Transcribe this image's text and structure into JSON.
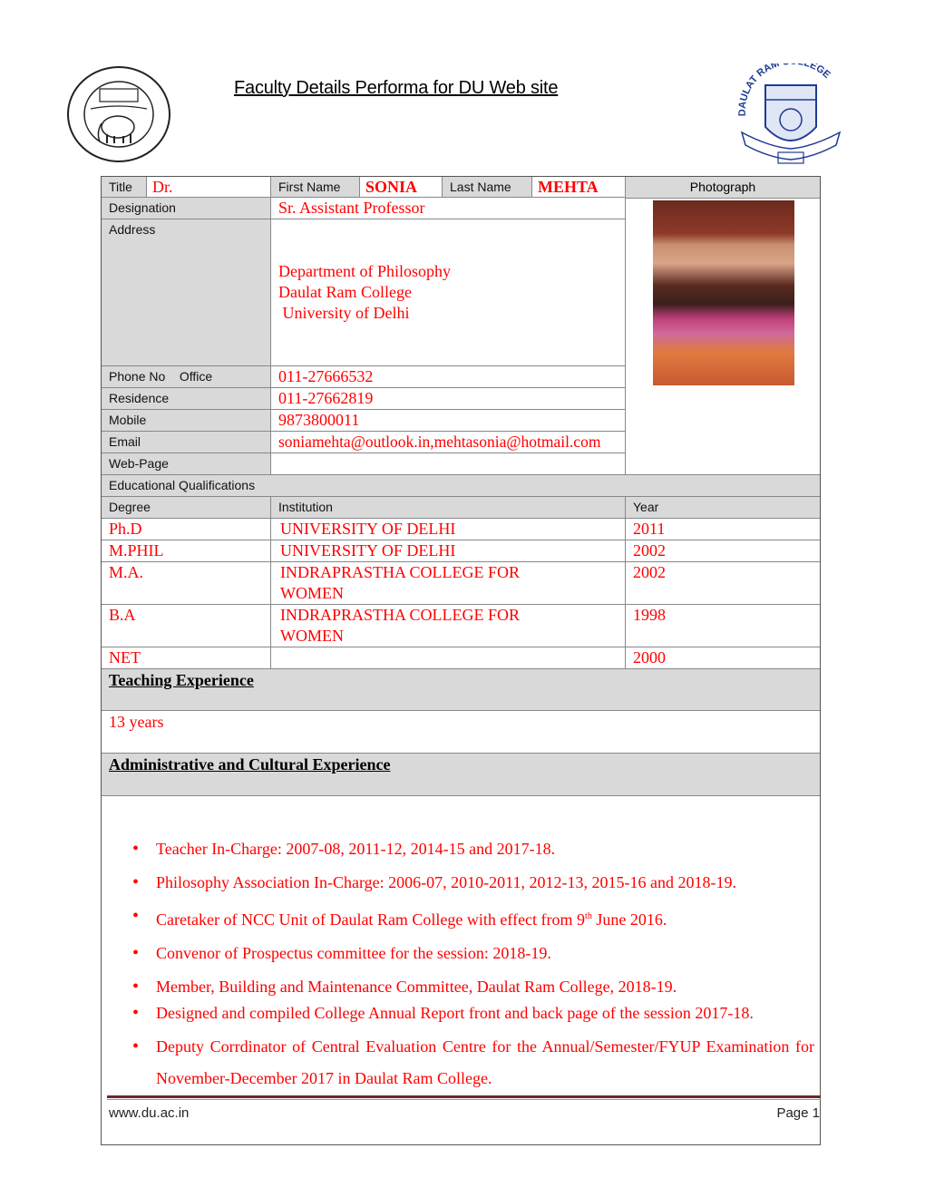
{
  "header": {
    "title": "Faculty Details Performa for DU Web site",
    "logo_left": "University of Delhi seal",
    "logo_right": "Daulat Ram College emblem"
  },
  "profile": {
    "title_label": "Title",
    "title_value": "Dr.",
    "first_name_label": "First Name",
    "first_name_value": "SONIA",
    "last_name_label": "Last Name",
    "last_name_value": "MEHTA",
    "photograph_label": "Photograph",
    "designation_label": "Designation",
    "designation_value": "Sr. Assistant Professor",
    "address_label": "Address",
    "address_lines": [
      "Department of Philosophy",
      "Daulat Ram College",
      " University of Delhi"
    ],
    "phone_office_label": "Phone No    Office",
    "phone_office_value": "011-27666532",
    "residence_label": "Residence",
    "residence_value": "011-27662819",
    "mobile_label": "Mobile",
    "mobile_value": "9873800011",
    "email_label": "Email",
    "email_value": "soniamehta@outlook.in,mehtasonia@hotmail.com",
    "webpage_label": "Web-Page",
    "webpage_value": ""
  },
  "education": {
    "section_label": "Educational Qualifications",
    "columns": [
      "Degree",
      "Institution",
      "Year"
    ],
    "rows": [
      {
        "degree": "Ph.D",
        "institution": "UNIVERSITY OF DELHI",
        "year": "2011"
      },
      {
        "degree": "M.PHIL",
        "institution": "UNIVERSITY OF DELHI",
        "year": "2002"
      },
      {
        "degree": "M.A.",
        "institution": "INDRAPRASTHA COLLEGE FOR WOMEN",
        "year": "2002"
      },
      {
        "degree": "B.A",
        "institution": "INDRAPRASTHA COLLEGE FOR WOMEN",
        "year": "1998"
      },
      {
        "degree": "NET",
        "institution": "",
        "year": "2000"
      }
    ]
  },
  "teaching": {
    "section_label": "Teaching Experience",
    "value": "13 years"
  },
  "admin": {
    "section_label": "Administrative and Cultural Experience",
    "items": [
      "Teacher In-Charge: 2007-08, 2011-12, 2014-15 and 2017-18.",
      "Philosophy Association In-Charge: 2006-07, 2010-2011, 2012-13, 2015-16 and 2018-19.",
      "Caretaker of NCC Unit of Daulat Ram College with effect from 9",
      "Convenor of Prospectus committee for the session: 2018-19.",
      "Member, Building and Maintenance Committee, Daulat Ram College, 2018-19.",
      "Designed and compiled College Annual Report front and back page of the session 2017-18.",
      "Deputy Corrdinator of Central Evaluation Centre for the Annual/Semester/FYUP Examination for November-December 2017 in Daulat Ram College."
    ],
    "item3_sup": "th",
    "item3_tail": " June 2016."
  },
  "footer": {
    "website": "www.du.ac.in",
    "page": "Page 1"
  }
}
